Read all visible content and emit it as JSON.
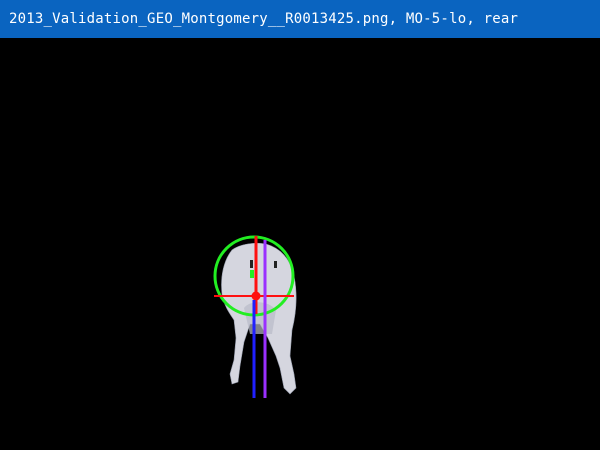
{
  "window": {
    "title": "2013_Validation_GEO_Montgomery__R0013425.png, MO-5-lo, rear"
  },
  "colors": {
    "titlebar_bg": "#0a64c0",
    "canvas_bg": "#000000",
    "circle": "#22ee22",
    "red_lines": "#ff1010",
    "blue_line": "#2020ff",
    "purple_line": "#9a30ff",
    "animal": "#d7d7e0"
  },
  "overlay": {
    "subject": "animal rear view",
    "annotations": [
      "green-circle",
      "red-crosshair",
      "blue-centerline",
      "purple-midline",
      "green-marker"
    ]
  }
}
